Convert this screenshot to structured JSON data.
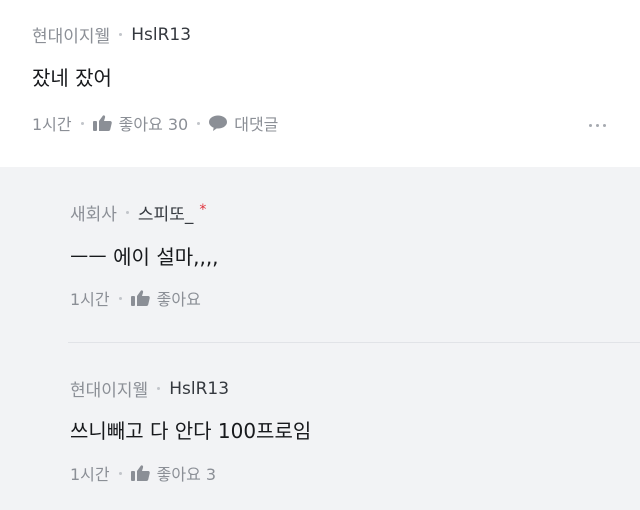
{
  "comments": [
    {
      "company": "현대이지웰",
      "nickname": "HslR13",
      "text": "잤네 잤어",
      "time": "1시간",
      "like_label": "좋아요 30",
      "reply_label": "대댓글"
    }
  ],
  "replies": [
    {
      "company": "새회사",
      "nickname": "스피또_",
      "badge": "*",
      "text": "ㅡㅡ 에이 설마,,,,",
      "time": "1시간",
      "like_label": "좋아요"
    },
    {
      "company": "현대이지웰",
      "nickname": "HslR13",
      "text": "쓰니빼고 다 안다 100프로임",
      "time": "1시간",
      "like_label": "좋아요 3"
    }
  ],
  "icons": {
    "like": "thumbs-up-icon",
    "reply": "speech-bubble-icon",
    "more": "more-horizontal-icon"
  },
  "colors": {
    "meta_gray": "#8b8f96",
    "nickname": "#35393f",
    "badge_red": "#e0303a",
    "reply_background": "#f2f3f5"
  }
}
